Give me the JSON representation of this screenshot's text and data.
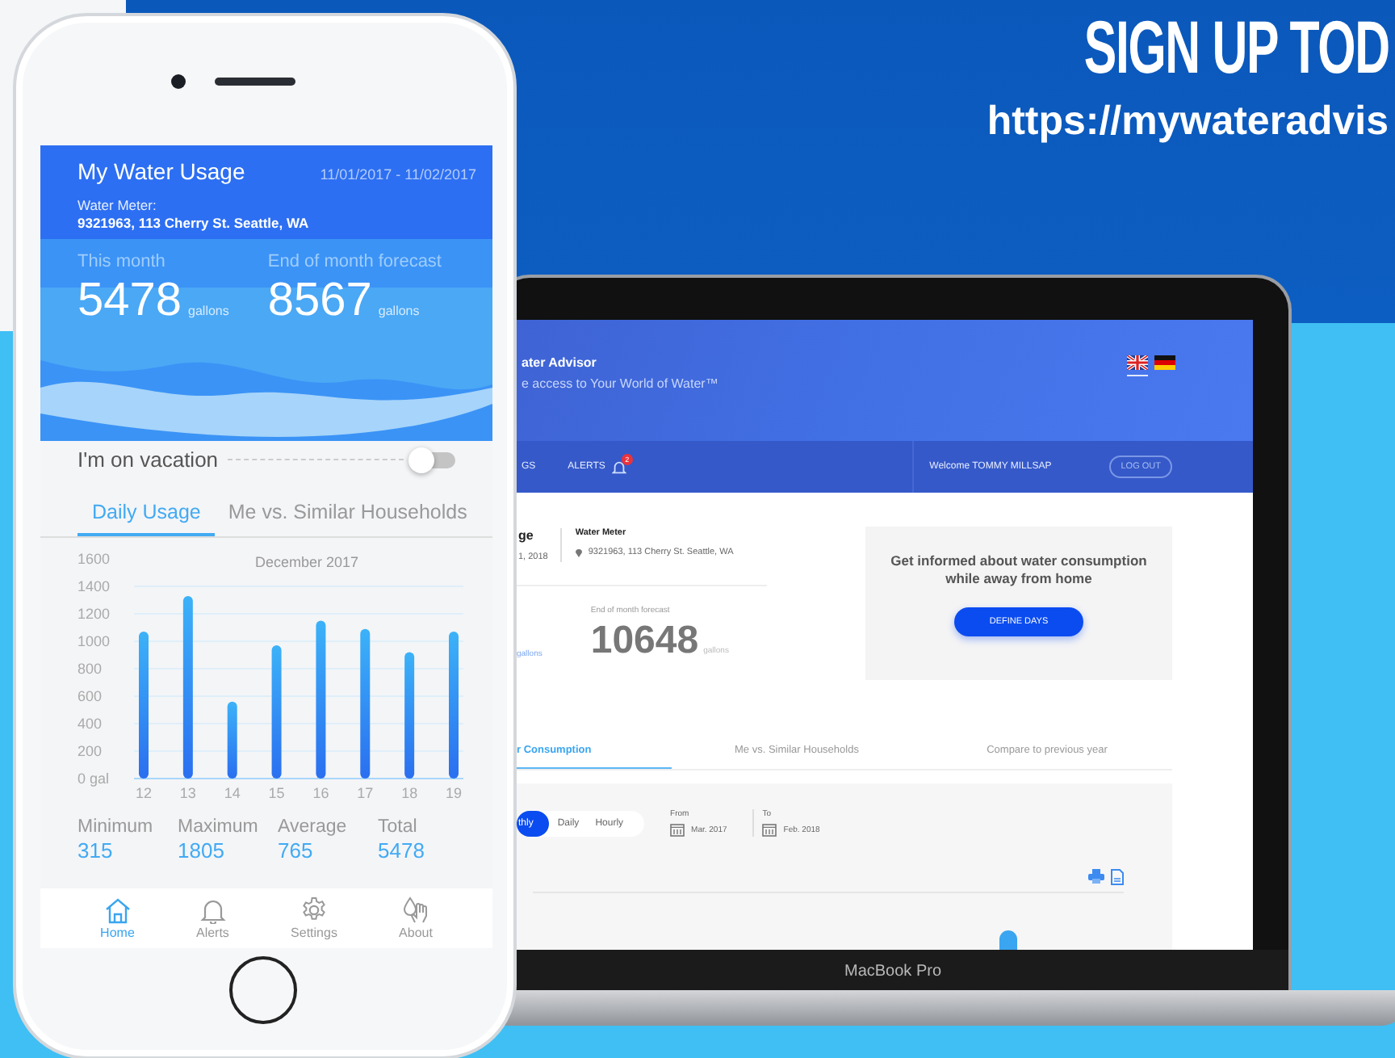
{
  "headline": {
    "title": "SIGN UP TOD",
    "url": "https://mywateradvis"
  },
  "phone": {
    "header": {
      "title": "My Water Usage",
      "dates": "11/01/2017 - 11/02/2017",
      "meter_label": "Water Meter:",
      "meter_value": "9321963, 113 Cherry St. Seattle, WA"
    },
    "usage": [
      {
        "label": "This month",
        "value": "5478",
        "unit": "gallons"
      },
      {
        "label": "End of month forecast",
        "value": "8567",
        "unit": "gallons"
      }
    ],
    "vacation": {
      "label": "I'm on vacation",
      "on": false
    },
    "tabs": [
      {
        "label": "Daily Usage",
        "selected": true
      },
      {
        "label": "Me vs. Similar Households",
        "selected": false
      }
    ],
    "chart_data": {
      "type": "bar",
      "title": "December 2017",
      "categories": [
        "12",
        "13",
        "14",
        "15",
        "16",
        "17",
        "18",
        "19"
      ],
      "values": [
        1070,
        1330,
        560,
        970,
        1150,
        1090,
        920,
        1070
      ],
      "ylim": [
        0,
        1600
      ],
      "grid": true,
      "yticks": [
        {
          "value": 0,
          "label": "0 gal"
        },
        200,
        400,
        600,
        800,
        1000,
        1200,
        1400,
        1600
      ]
    },
    "stats": [
      {
        "label": "Minimum",
        "value": "315"
      },
      {
        "label": "Maximum",
        "value": "1805"
      },
      {
        "label": "Average",
        "value": "765"
      },
      {
        "label": "Total",
        "value": "5478"
      }
    ],
    "nav": [
      {
        "label": "Home",
        "selected": true
      },
      {
        "label": "Alerts",
        "selected": false
      },
      {
        "label": "Settings",
        "selected": false
      },
      {
        "label": "About",
        "selected": false
      }
    ]
  },
  "laptop": {
    "brand": {
      "title": "ater Advisor",
      "tagline": "e access to Your World of Water™"
    },
    "languages": [
      {
        "selected": true
      },
      {
        "selected": false
      }
    ],
    "nav": [
      {
        "label": "GS"
      },
      {
        "label": "ALERTS",
        "badge": "2"
      }
    ],
    "welcome": "Welcome TOMMY MILLSAP",
    "logout": "LOG OUT",
    "summary": {
      "title": "ge",
      "date": "1, 2018",
      "meter_label": "Water Meter",
      "meter_value": "9321963, 113 Cherry St. Seattle, WA"
    },
    "usage": [
      {
        "unit": "gallons"
      },
      {
        "label": "End of month forecast",
        "value": "10648",
        "unit": "gallons"
      }
    ],
    "vacation_card": {
      "text": "Get informed about water consumption while away from home",
      "button": "DEFINE DAYS"
    },
    "tabs": [
      {
        "label": "r Consumption",
        "selected": true
      },
      {
        "label": "Me vs. Similar Households",
        "selected": false
      },
      {
        "label": "Compare to previous year",
        "selected": false
      }
    ],
    "periods": [
      {
        "label": "thly",
        "selected": true
      },
      {
        "label": "Daily",
        "selected": false
      },
      {
        "label": "Hourly",
        "selected": false
      }
    ],
    "range": [
      {
        "label": "From",
        "value": "Mar. 2017"
      },
      {
        "label": "To",
        "value": "Feb. 2018"
      }
    ],
    "model": "MacBook Pro"
  }
}
